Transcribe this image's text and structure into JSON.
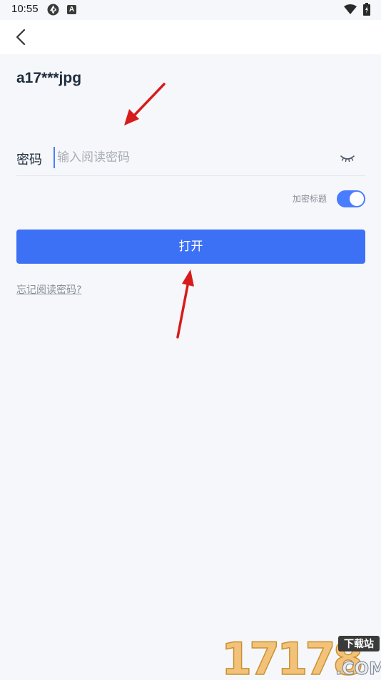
{
  "status_bar": {
    "time": "10:55",
    "app_icon_b": "A"
  },
  "nav": {
    "back_icon": "chevron-left-icon"
  },
  "file": {
    "name": "a17***jpg"
  },
  "password": {
    "label": "密码",
    "placeholder": "输入阅读密码",
    "value": "",
    "eye_icon": "eye-closed-icon"
  },
  "encrypt_title": {
    "label": "加密标题",
    "enabled": true
  },
  "actions": {
    "open_label": "打开",
    "forgot_label": "忘记阅读密码?"
  },
  "watermark": {
    "digits": "17178",
    "badge": "下载站",
    "domain": ".COM"
  },
  "colors": {
    "accent": "#3d71f5",
    "background": "#f5f7fa",
    "arrow": "#e01e1e"
  }
}
